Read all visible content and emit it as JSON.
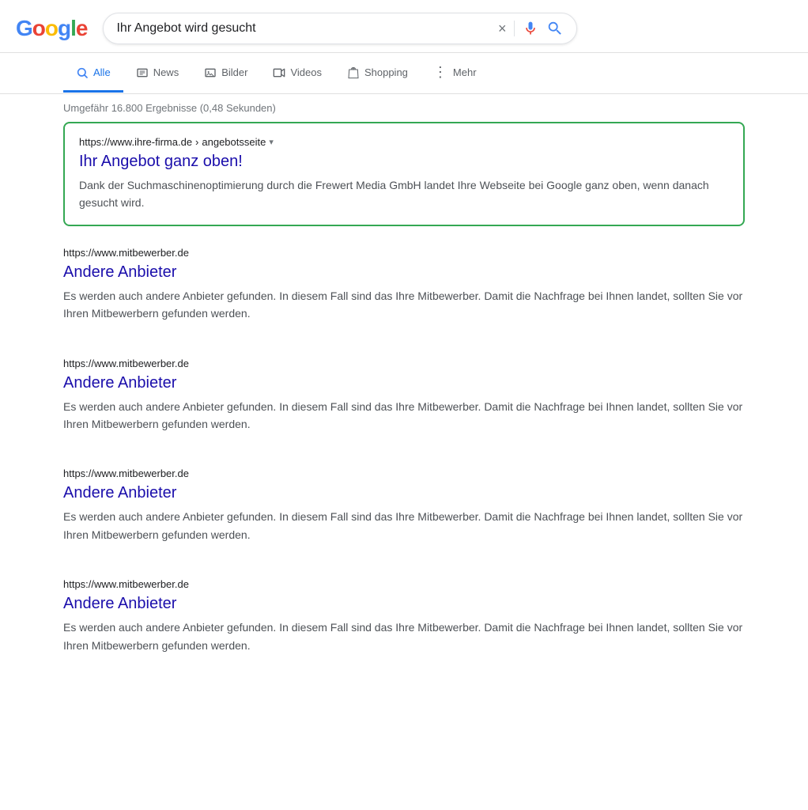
{
  "header": {
    "logo": {
      "letters": [
        "G",
        "o",
        "o",
        "g",
        "l",
        "e"
      ]
    },
    "search": {
      "value": "Ihr Angebot wird gesucht",
      "clear_label": "×"
    }
  },
  "tabs": [
    {
      "id": "alle",
      "label": "Alle",
      "active": true,
      "icon": "🔍"
    },
    {
      "id": "news",
      "label": "News",
      "active": false,
      "icon": "📰"
    },
    {
      "id": "bilder",
      "label": "Bilder",
      "active": false,
      "icon": "🖼"
    },
    {
      "id": "videos",
      "label": "Videos",
      "active": false,
      "icon": "▶"
    },
    {
      "id": "shopping",
      "label": "Shopping",
      "active": false,
      "icon": "🏷"
    },
    {
      "id": "mehr",
      "label": "Mehr",
      "active": false,
      "icon": "⋮"
    }
  ],
  "results_info": {
    "text": "Umgefähr 16.800 Ergebnisse (0,48 Sekunden)"
  },
  "featured_result": {
    "url": "https://www.ihre-firma.de",
    "url_path": "angebotsseite",
    "title": "Ihr Angebot ganz oben!",
    "snippet": "Dank der Suchmaschinenoptimierung durch die Frewert Media GmbH landet Ihre Webseite bei Google ganz oben, wenn danach gesucht wird."
  },
  "competitor_results": [
    {
      "url": "https://www.mitbewerber.de",
      "title": "Andere Anbieter",
      "snippet": "Es werden auch andere Anbieter gefunden. In diesem Fall sind das Ihre Mitbewerber. Damit die Nachfrage bei Ihnen landet, sollten Sie vor Ihren Mitbewerbern gefunden werden."
    },
    {
      "url": "https://www.mitbewerber.de",
      "title": "Andere Anbieter",
      "snippet": "Es werden auch andere Anbieter gefunden. In diesem Fall sind das Ihre Mitbewerber. Damit die Nachfrage bei Ihnen landet, sollten Sie vor Ihren Mitbewerbern gefunden werden."
    },
    {
      "url": "https://www.mitbewerber.de",
      "title": "Andere Anbieter",
      "snippet": "Es werden auch andere Anbieter gefunden. In diesem Fall sind das Ihre Mitbewerber. Damit die Nachfrage bei Ihnen landet, sollten Sie vor Ihren Mitbewerbern gefunden werden."
    },
    {
      "url": "https://www.mitbewerber.de",
      "title": "Andere Anbieter",
      "snippet": "Es werden auch andere Anbieter gefunden. In diesem Fall sind das Ihre Mitbewerber. Damit die Nachfrage bei Ihnen landet, sollten Sie vor Ihren Mitbewerbern gefunden werden."
    }
  ],
  "colors": {
    "google_blue": "#4285F4",
    "google_red": "#EA4335",
    "google_yellow": "#FBBC05",
    "google_green": "#34A853",
    "link_color": "#1a0dab",
    "tab_active": "#1a73e8",
    "highlight_border": "#34A853"
  }
}
